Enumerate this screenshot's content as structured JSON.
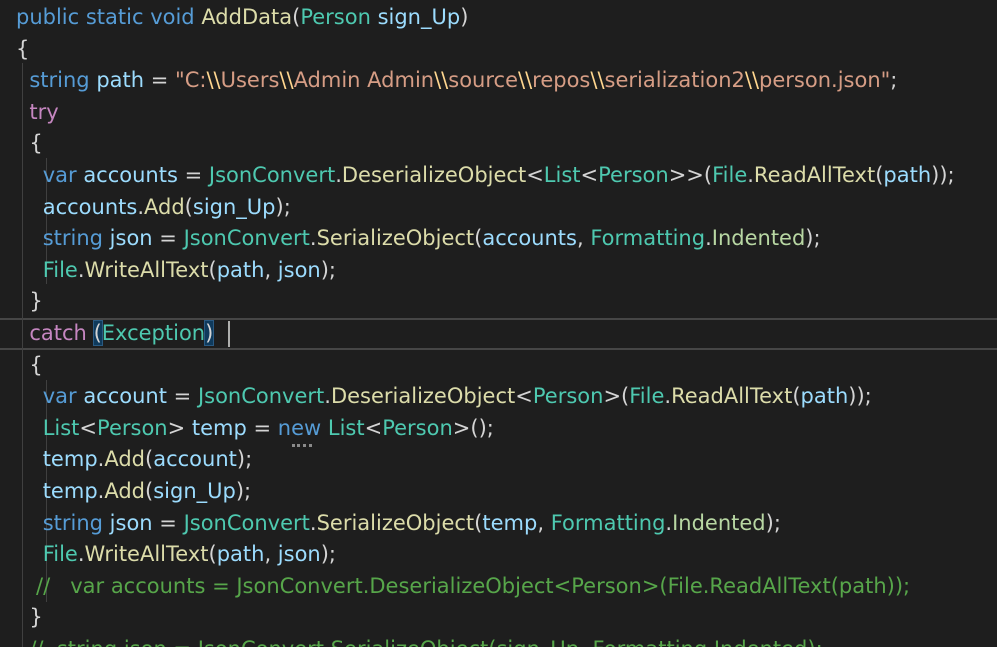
{
  "editor": {
    "lines": [
      {
        "tokens": [
          {
            "t": "public static void ",
            "c": "kw"
          },
          {
            "t": "AddData",
            "c": "fn"
          },
          {
            "t": "(",
            "c": "punc"
          },
          {
            "t": "Person",
            "c": "type"
          },
          {
            "t": " sign_Up",
            "c": "var"
          },
          {
            "t": ")",
            "c": "punc"
          }
        ]
      },
      {
        "tokens": [
          {
            "t": "{",
            "c": "punc"
          }
        ]
      },
      {
        "tokens": [
          {
            "t": "  "
          },
          {
            "t": "string",
            "c": "kw"
          },
          {
            "t": " path",
            "c": "var"
          },
          {
            "t": " = ",
            "c": "punc"
          },
          {
            "t": "\"C:",
            "c": "str"
          },
          {
            "t": "\\\\",
            "c": "esc"
          },
          {
            "t": "Users",
            "c": "str"
          },
          {
            "t": "\\\\",
            "c": "esc"
          },
          {
            "t": "Admin Admin",
            "c": "str"
          },
          {
            "t": "\\\\",
            "c": "esc"
          },
          {
            "t": "source",
            "c": "str"
          },
          {
            "t": "\\\\",
            "c": "esc"
          },
          {
            "t": "repos",
            "c": "str"
          },
          {
            "t": "\\\\",
            "c": "esc"
          },
          {
            "t": "serialization2",
            "c": "str"
          },
          {
            "t": "\\\\",
            "c": "esc"
          },
          {
            "t": "person.json\"",
            "c": "str"
          },
          {
            "t": ";",
            "c": "punc"
          }
        ]
      },
      {
        "tokens": [
          {
            "t": "  "
          },
          {
            "t": "try",
            "c": "ctl"
          }
        ]
      },
      {
        "tokens": [
          {
            "t": "  "
          },
          {
            "t": "{",
            "c": "punc"
          }
        ]
      },
      {
        "tokens": [
          {
            "t": "    "
          },
          {
            "t": "var",
            "c": "kw"
          },
          {
            "t": " accounts",
            "c": "var"
          },
          {
            "t": " = ",
            "c": "punc"
          },
          {
            "t": "JsonConvert",
            "c": "type"
          },
          {
            "t": ".",
            "c": "punc"
          },
          {
            "t": "DeserializeObject",
            "c": "fn"
          },
          {
            "t": "<",
            "c": "punc"
          },
          {
            "t": "List",
            "c": "type"
          },
          {
            "t": "<",
            "c": "punc"
          },
          {
            "t": "Person",
            "c": "type"
          },
          {
            "t": ">>(",
            "c": "punc"
          },
          {
            "t": "File",
            "c": "type"
          },
          {
            "t": ".",
            "c": "punc"
          },
          {
            "t": "ReadAllText",
            "c": "fn"
          },
          {
            "t": "(",
            "c": "punc"
          },
          {
            "t": "path",
            "c": "var"
          },
          {
            "t": "));",
            "c": "punc"
          }
        ]
      },
      {
        "tokens": [
          {
            "t": "    "
          },
          {
            "t": "accounts",
            "c": "var"
          },
          {
            "t": ".",
            "c": "punc"
          },
          {
            "t": "Add",
            "c": "fn"
          },
          {
            "t": "(",
            "c": "punc"
          },
          {
            "t": "sign_Up",
            "c": "var"
          },
          {
            "t": ");",
            "c": "punc"
          }
        ]
      },
      {
        "tokens": [
          {
            "t": "    "
          },
          {
            "t": "string",
            "c": "kw"
          },
          {
            "t": " json",
            "c": "var"
          },
          {
            "t": " = ",
            "c": "punc"
          },
          {
            "t": "JsonConvert",
            "c": "type"
          },
          {
            "t": ".",
            "c": "punc"
          },
          {
            "t": "SerializeObject",
            "c": "fn"
          },
          {
            "t": "(",
            "c": "punc"
          },
          {
            "t": "accounts",
            "c": "var"
          },
          {
            "t": ", ",
            "c": "punc"
          },
          {
            "t": "Formatting",
            "c": "type"
          },
          {
            "t": ".",
            "c": "punc"
          },
          {
            "t": "Indented",
            "c": "enum"
          },
          {
            "t": ");",
            "c": "punc"
          }
        ]
      },
      {
        "tokens": [
          {
            "t": "    "
          },
          {
            "t": "File",
            "c": "type"
          },
          {
            "t": ".",
            "c": "punc"
          },
          {
            "t": "WriteAllText",
            "c": "fn"
          },
          {
            "t": "(",
            "c": "punc"
          },
          {
            "t": "path",
            "c": "var"
          },
          {
            "t": ", ",
            "c": "punc"
          },
          {
            "t": "json",
            "c": "var"
          },
          {
            "t": ");",
            "c": "punc"
          }
        ]
      },
      {
        "tokens": [
          {
            "t": "  "
          },
          {
            "t": "}",
            "c": "punc"
          }
        ]
      },
      {
        "tokens": [
          {
            "t": "  "
          },
          {
            "t": "catch",
            "c": "ctl"
          },
          {
            "t": " "
          },
          {
            "t": "(",
            "c": "punc",
            "hl": true
          },
          {
            "t": "Exception",
            "c": "type"
          },
          {
            "t": ")",
            "c": "punc",
            "hl": true
          }
        ]
      },
      {
        "tokens": [
          {
            "t": "  "
          },
          {
            "t": "{",
            "c": "punc"
          }
        ]
      },
      {
        "tokens": [
          {
            "t": "    "
          },
          {
            "t": "var",
            "c": "kw"
          },
          {
            "t": " account",
            "c": "var"
          },
          {
            "t": " = ",
            "c": "punc"
          },
          {
            "t": "JsonConvert",
            "c": "type"
          },
          {
            "t": ".",
            "c": "punc"
          },
          {
            "t": "DeserializeObject",
            "c": "fn"
          },
          {
            "t": "<",
            "c": "punc"
          },
          {
            "t": "Person",
            "c": "type"
          },
          {
            "t": ">(",
            "c": "punc"
          },
          {
            "t": "File",
            "c": "type"
          },
          {
            "t": ".",
            "c": "punc"
          },
          {
            "t": "ReadAllText",
            "c": "fn"
          },
          {
            "t": "(",
            "c": "punc"
          },
          {
            "t": "path",
            "c": "var"
          },
          {
            "t": "));",
            "c": "punc"
          }
        ]
      },
      {
        "tokens": [
          {
            "t": "    "
          },
          {
            "t": "List",
            "c": "type"
          },
          {
            "t": "<",
            "c": "punc"
          },
          {
            "t": "Person",
            "c": "type"
          },
          {
            "t": ">",
            "c": "punc"
          },
          {
            "t": " temp",
            "c": "var"
          },
          {
            "t": " = ",
            "c": "punc"
          },
          {
            "t": "new",
            "c": "kw"
          },
          {
            "t": " List",
            "c": "type"
          },
          {
            "t": "<",
            "c": "punc"
          },
          {
            "t": "Person",
            "c": "type"
          },
          {
            "t": ">();",
            "c": "punc"
          }
        ]
      },
      {
        "tokens": [
          {
            "t": "    "
          },
          {
            "t": "temp",
            "c": "var"
          },
          {
            "t": ".",
            "c": "punc"
          },
          {
            "t": "Add",
            "c": "fn"
          },
          {
            "t": "(",
            "c": "punc"
          },
          {
            "t": "account",
            "c": "var"
          },
          {
            "t": ");",
            "c": "punc"
          }
        ]
      },
      {
        "tokens": [
          {
            "t": "    "
          },
          {
            "t": "temp",
            "c": "var"
          },
          {
            "t": ".",
            "c": "punc"
          },
          {
            "t": "Add",
            "c": "fn"
          },
          {
            "t": "(",
            "c": "punc"
          },
          {
            "t": "sign_Up",
            "c": "var"
          },
          {
            "t": ");",
            "c": "punc"
          }
        ]
      },
      {
        "tokens": [
          {
            "t": "    "
          },
          {
            "t": "string",
            "c": "kw"
          },
          {
            "t": " json",
            "c": "var"
          },
          {
            "t": " = ",
            "c": "punc"
          },
          {
            "t": "JsonConvert",
            "c": "type"
          },
          {
            "t": ".",
            "c": "punc"
          },
          {
            "t": "SerializeObject",
            "c": "fn"
          },
          {
            "t": "(",
            "c": "punc"
          },
          {
            "t": "temp",
            "c": "var"
          },
          {
            "t": ", ",
            "c": "punc"
          },
          {
            "t": "Formatting",
            "c": "type"
          },
          {
            "t": ".",
            "c": "punc"
          },
          {
            "t": "Indented",
            "c": "enum"
          },
          {
            "t": ");",
            "c": "punc"
          }
        ]
      },
      {
        "tokens": [
          {
            "t": "    "
          },
          {
            "t": "File",
            "c": "type"
          },
          {
            "t": ".",
            "c": "punc"
          },
          {
            "t": "WriteAllText",
            "c": "fn"
          },
          {
            "t": "(",
            "c": "punc"
          },
          {
            "t": "path",
            "c": "var"
          },
          {
            "t": ", ",
            "c": "punc"
          },
          {
            "t": "json",
            "c": "var"
          },
          {
            "t": ");",
            "c": "punc"
          }
        ]
      },
      {
        "tokens": [
          {
            "t": "   "
          },
          {
            "t": "//   var accounts = JsonConvert.DeserializeObject<Person>(File.ReadAllText(path));",
            "c": "cmt"
          }
        ]
      },
      {
        "tokens": [
          {
            "t": "  "
          },
          {
            "t": "}",
            "c": "punc"
          }
        ]
      },
      {
        "tokens": [
          {
            "t": "  "
          },
          {
            "t": "//  string json = JsonConvert.SerializeObject(sign_Up, Formatting.Indented);",
            "c": "cmt"
          }
        ]
      }
    ]
  }
}
